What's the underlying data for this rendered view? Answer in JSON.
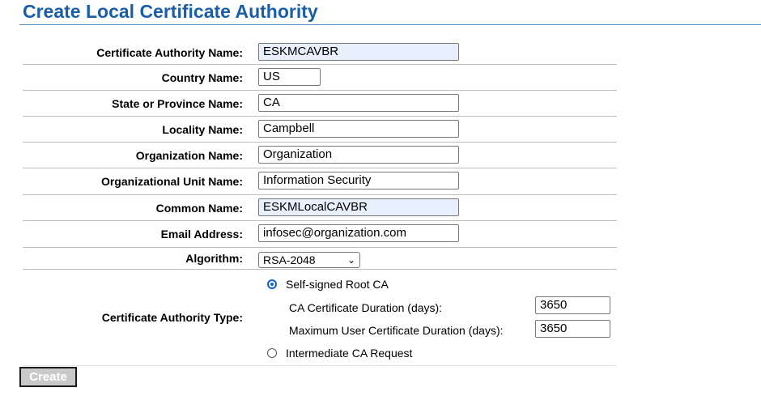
{
  "page": {
    "title": "Create Local Certificate Authority"
  },
  "form": {
    "ca_name": {
      "label": "Certificate Authority Name:",
      "value": "ESKMCAVBR"
    },
    "country": {
      "label": "Country Name:",
      "value": "US"
    },
    "state": {
      "label": "State or Province Name:",
      "value": "CA"
    },
    "locality": {
      "label": "Locality Name:",
      "value": "Campbell"
    },
    "organization": {
      "label": "Organization Name:",
      "value": "Organization"
    },
    "org_unit": {
      "label": "Organizational Unit Name:",
      "value": "Information Security"
    },
    "common_name": {
      "label": "Common Name:",
      "value": "ESKMLocalCAVBR"
    },
    "email": {
      "label": "Email Address:",
      "value": "infosec@organization.com"
    },
    "algorithm": {
      "label": "Algorithm:",
      "selected": "RSA-2048"
    },
    "ca_type": {
      "label": "Certificate Authority Type:",
      "self_signed_label": "Self-signed Root CA",
      "self_signed_selected": true,
      "ca_duration_label": "CA Certificate Duration (days):",
      "ca_duration_value": "3650",
      "max_user_duration_label": "Maximum User Certificate Duration (days):",
      "max_user_duration_value": "3650",
      "intermediate_label": "Intermediate CA Request",
      "intermediate_selected": false
    }
  },
  "actions": {
    "create_label": "Create"
  },
  "colors": {
    "title": "#1a5ea6",
    "autofill": "#e8f0fe",
    "radio_accent": "#0b63d1",
    "button_disabled": "#c9c9c9"
  }
}
